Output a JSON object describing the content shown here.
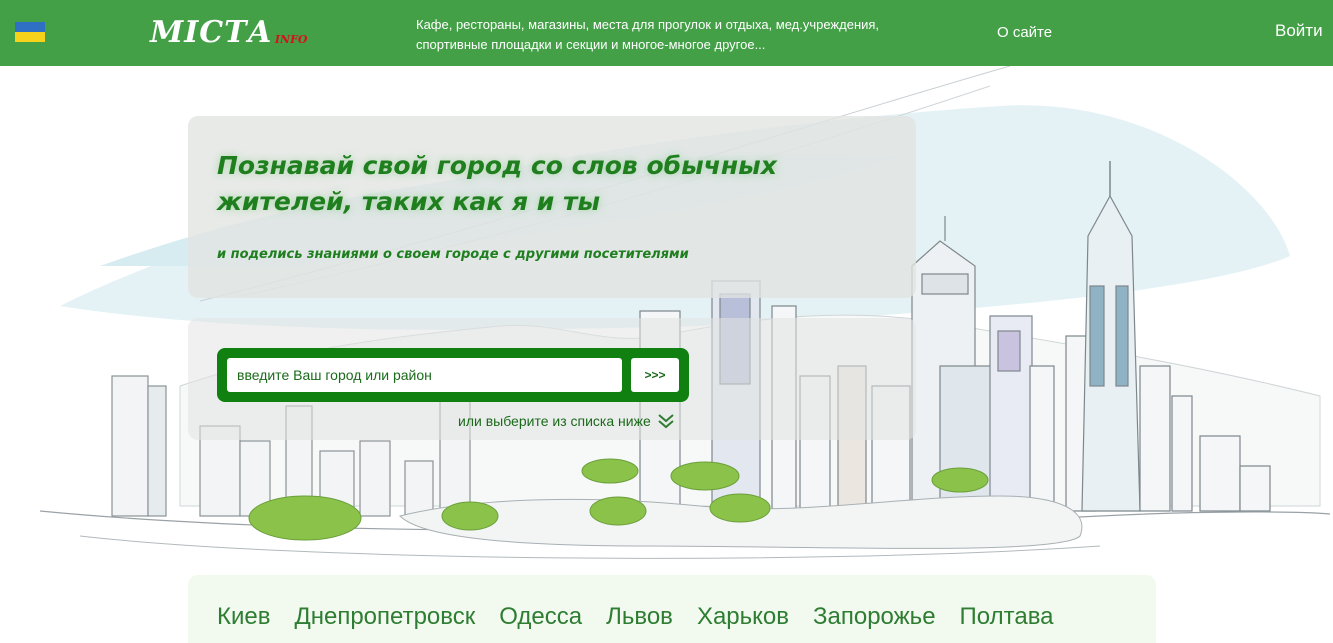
{
  "header": {
    "logo_main": "МІСТА",
    "logo_sub": "INFO",
    "tagline": "Кафе, рестораны, магазины, места для прогулок и отдыха, мед.учреждения, спортивные площадки и секции и многое-многое другое...",
    "about_label": "О сайте",
    "login_label": "Войти",
    "flag_colors": [
      "#2f6fc4",
      "#f6d21a"
    ]
  },
  "hero": {
    "headline": "Познавай свой город со слов обычных жителей, таких как я и ты",
    "subline": "и поделись знаниями о своем городе с другими посетителями"
  },
  "search": {
    "placeholder": "введите Ваш город или район",
    "button_label": ">>>",
    "choose_label": "или выберите из списка ниже"
  },
  "cities": [
    "Киев",
    "Днепропетровск",
    "Одесса",
    "Львов",
    "Харьков",
    "Запорожье",
    "Полтава"
  ],
  "colors": {
    "header_bg": "#43a047",
    "accent": "#108010",
    "text_green": "#1f7f1f"
  }
}
